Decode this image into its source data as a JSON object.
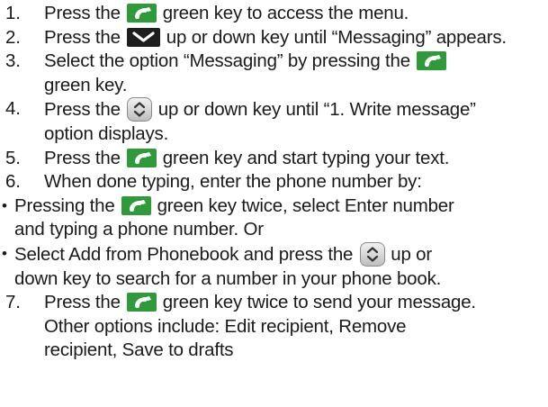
{
  "steps": {
    "s1": {
      "num": "1.",
      "a": "Press the",
      "b": "green key to access the menu."
    },
    "s2": {
      "num": "2.",
      "a": "Press the",
      "b": "up or down key until “Messaging” appears."
    },
    "s3": {
      "num": "3.",
      "a": "Select the option “Messaging” by pressing the",
      "c": "green key."
    },
    "s4": {
      "num": "4.",
      "a": "Press the",
      "b": "up or down key until “1. Write message”",
      "c": "option displays."
    },
    "s5": {
      "num": "5.",
      "a": "Press the",
      "b": "green key and start typing your text."
    },
    "s6": {
      "num": "6.",
      "a": "When done typing, enter the phone number by:"
    },
    "b1": {
      "bullet": "•",
      "a": "Pressing the",
      "b": "green key twice, select Enter number",
      "c": "and typing a phone number. Or"
    },
    "b2": {
      "bullet": "•",
      "a": "Select Add from Phonebook and press the",
      "b": "up or",
      "c": "down key to search for a number in your phone book."
    },
    "s7": {
      "num": "7.",
      "a": "Press the",
      "b": "green key twice to send your message.",
      "c": "Other options include: Edit recipient, Remove",
      "d": "recipient, Save to drafts"
    }
  },
  "icons": {
    "green_key": "call-green-key-icon",
    "down_key": "down-arrow-key-icon",
    "nav_key": "up-down-navigation-key-icon"
  },
  "colors": {
    "green_key_bg": "#2e9a3a",
    "green_key_symbol": "#ffffff",
    "down_key_bg": "#1e1e1e",
    "nav_key_bg": "#d9d9d9"
  }
}
